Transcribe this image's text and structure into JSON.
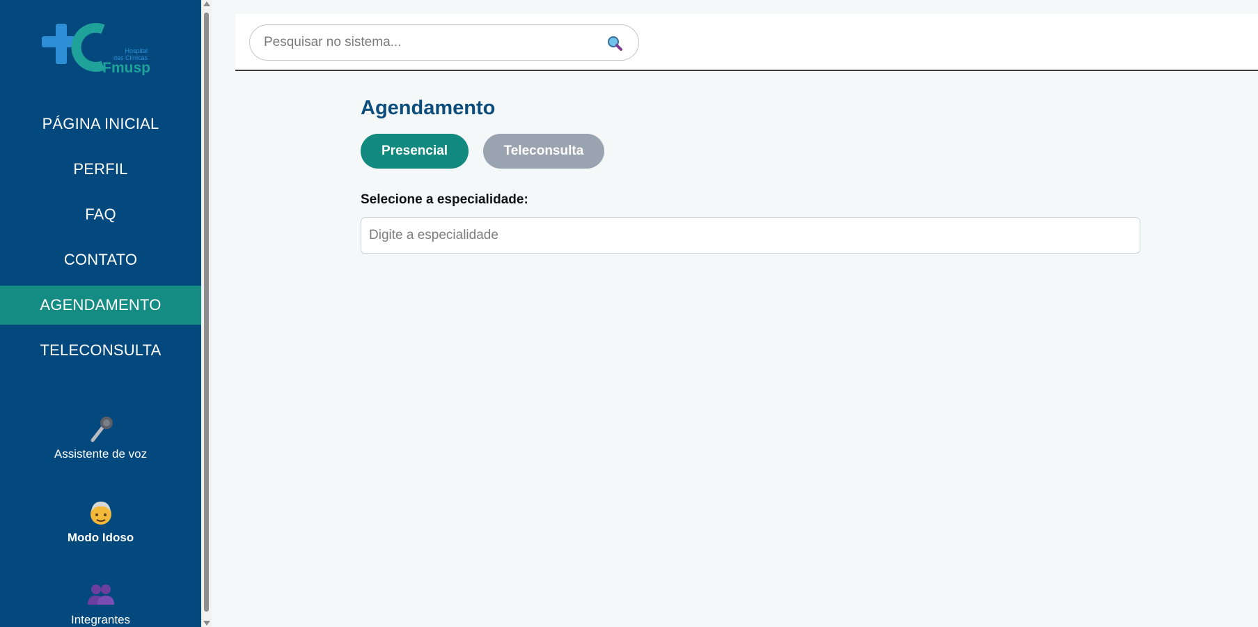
{
  "brand": {
    "logo_text_lines": [
      "Hospital",
      "das Clínicas",
      "Fmusp"
    ],
    "logo_icon": "hc-logo-icon"
  },
  "sidebar": {
    "items": [
      {
        "label": "PÁGINA INICIAL",
        "active": false
      },
      {
        "label": "PERFIL",
        "active": false
      },
      {
        "label": "FAQ",
        "active": false
      },
      {
        "label": "CONTATO",
        "active": false
      },
      {
        "label": "AGENDAMENTO",
        "active": true
      },
      {
        "label": "TELECONSULTA",
        "active": false
      }
    ],
    "tools": {
      "voice": {
        "label": "Assistente de voz",
        "icon": "microphone-icon"
      },
      "elder": {
        "label": "Modo Idoso",
        "icon": "elderly-person-icon"
      },
      "team": {
        "label": "Integrantes",
        "icon": "group-people-icon"
      }
    }
  },
  "header": {
    "search": {
      "placeholder": "Pesquisar no sistema...",
      "value": "",
      "icon": "search-icon"
    }
  },
  "main": {
    "title": "Agendamento",
    "modes": [
      {
        "label": "Presencial",
        "selected": true
      },
      {
        "label": "Teleconsulta",
        "selected": false
      }
    ],
    "specialty": {
      "label": "Selecione a especialidade:",
      "placeholder": "Digite a especialidade",
      "value": ""
    }
  },
  "colors": {
    "sidebar_bg": "#03497d",
    "active_item": "#148c83",
    "primary_button": "#138a80",
    "secondary_button": "#9aa3b0",
    "title": "#0c4d7c",
    "page_bg": "#f4f8f9"
  }
}
